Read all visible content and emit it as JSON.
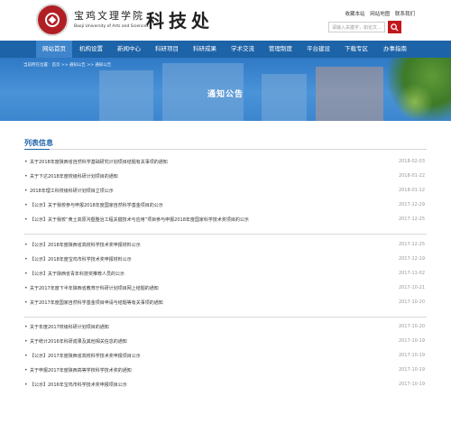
{
  "header": {
    "school_cn": "宝鸡文理学院",
    "school_en": "Baoji University of Arts and Sciences",
    "dept": "科技处",
    "links": [
      "收藏本站",
      "网站地图",
      "联系我们"
    ],
    "search_placeholder": "请输入关键字，如论文…"
  },
  "nav": {
    "items": [
      "网站首页",
      "机构设置",
      "新闻中心",
      "科研项目",
      "科研成果",
      "学术交流",
      "管理制度",
      "平台建设",
      "下载专区",
      "办事指南"
    ]
  },
  "banner": {
    "breadcrumb": "当前所在位置：首页 >> 通知公告 >> 通知公告",
    "title": "通知公告"
  },
  "list": {
    "heading": "列表信息",
    "group1": [
      {
        "text": "关于2018年度陕西省自然科学基础研究计划项目结题有关事项的通知",
        "date": "2018-02-03"
      },
      {
        "text": "关于下达2018年度校级科研计划项目的通知",
        "date": "2018-01-22"
      },
      {
        "text": "2018年理工科校级科研计划项目立项公示",
        "date": "2018-01-12"
      },
      {
        "text": "【公示】关于我校参与申报2018年度国家自然科学基金项目的公示",
        "date": "2017-12-29"
      },
      {
        "text": "【公示】关于我校“黄土高原沟壑整治工程关键技术与应用”项目参与申报2018年度国家科学技术奖项目的公示",
        "date": "2017-12-25"
      }
    ],
    "group2": [
      {
        "text": "【公示】2018年度陕西省高校科学技术奖申报材料公示",
        "date": "2017-12-25"
      },
      {
        "text": "【公示】2018年度宝鸡市科学技术奖申报材料公示",
        "date": "2017-12-19"
      },
      {
        "text": "【公示】关于陕西省青年科技奖推荐人员的公示",
        "date": "2017-11-02"
      },
      {
        "text": "关于2017年度下半年陕西省教育厅科研计划项目网上结题的通知",
        "date": "2017-10-21"
      },
      {
        "text": "关于2017年度国家自然科学基金项目申请与结题等有关事项的通知",
        "date": "2017-10-20"
      }
    ],
    "group3": [
      {
        "text": "关于年度2017校级科研计划项目的通知",
        "date": "2017-10-20"
      },
      {
        "text": "关于统计2016年科研成果及其他相关信息的通知",
        "date": "2017-10-19"
      },
      {
        "text": "【公示】2017年度陕西省高校科学技术奖申报项目公示",
        "date": "2017-10-19"
      },
      {
        "text": "关于申报2017年度陕西高等学校科学技术奖的通知",
        "date": "2017-10-19"
      },
      {
        "text": "【公示】2016年宝鸡市科学技术奖申报项目公示",
        "date": "2017-10-19"
      }
    ]
  }
}
